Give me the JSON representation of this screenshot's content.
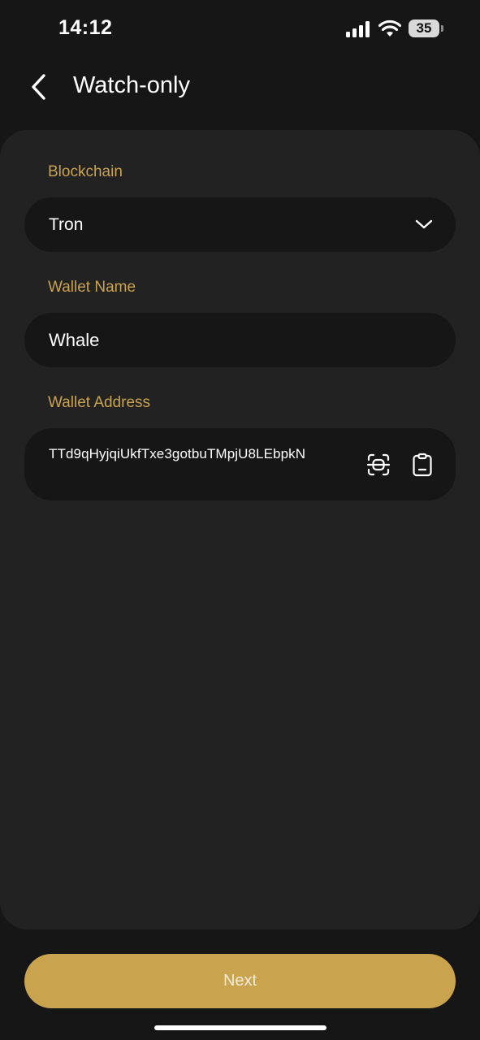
{
  "status_bar": {
    "time": "14:12",
    "battery": "35"
  },
  "header": {
    "title": "Watch-only",
    "back_icon": "chevron-left-icon"
  },
  "form": {
    "blockchain": {
      "label": "Blockchain",
      "value": "Tron",
      "icon": "chevron-down-icon"
    },
    "wallet_name": {
      "label": "Wallet Name",
      "value": "Whale"
    },
    "wallet_address": {
      "label": "Wallet Address",
      "value": "TTd9qHyjqiUkfTxe3gotbuTMpjU8LEbpkN",
      "scan_icon": "scan-icon",
      "paste_icon": "paste-icon"
    }
  },
  "footer": {
    "next_label": "Next"
  },
  "colors": {
    "accent": "#c9a34e",
    "background": "#161616",
    "card": "#222222",
    "field": "#161616"
  }
}
